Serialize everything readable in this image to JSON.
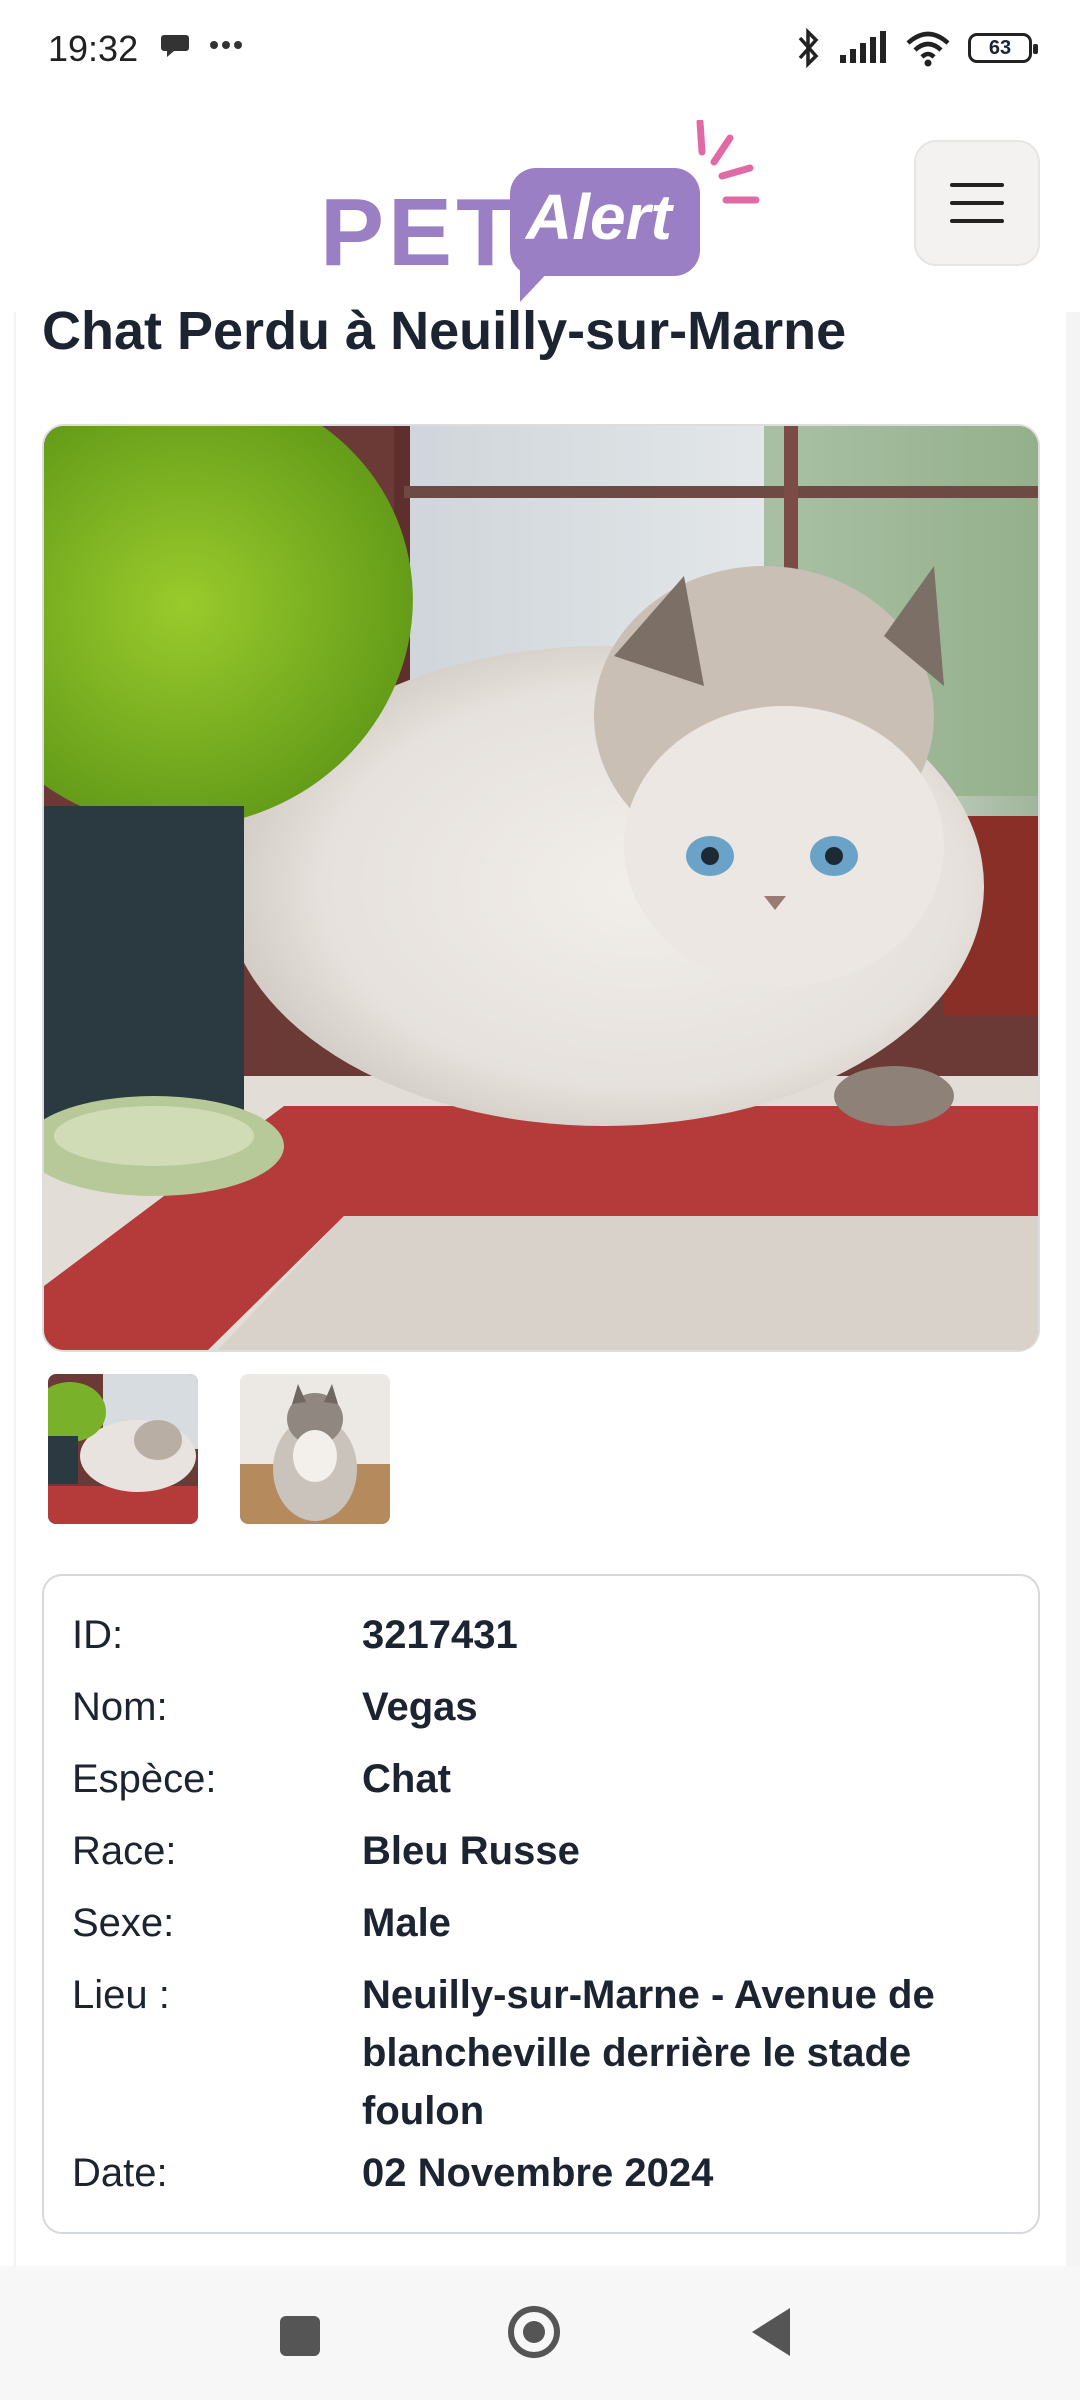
{
  "status_bar": {
    "time": "19:32",
    "battery": "63",
    "icons": [
      "chat-bubble-icon",
      "more-dots-icon",
      "bluetooth-icon",
      "signal-icon",
      "wifi-icon",
      "battery-icon"
    ]
  },
  "header": {
    "logo_pet": "PET",
    "logo_alert": "Alert",
    "menu_icon": "hamburger-menu-icon"
  },
  "page": {
    "title": "Chat Perdu à Neuilly-sur-Marne"
  },
  "photos": {
    "main": "cat-photo",
    "thumbnails": [
      "cat-thumbnail-1",
      "cat-thumbnail-2"
    ]
  },
  "details": {
    "id_label": "ID:",
    "id_value": "3217431",
    "nom_label": "Nom:",
    "nom_value": "Vegas",
    "espece_label": "Espèce:",
    "espece_value": "Chat",
    "race_label": "Race:",
    "race_value": "Bleu Russe",
    "sexe_label": "Sexe:",
    "sexe_value": "Male",
    "lieu_label": "Lieu :",
    "lieu_value": "Neuilly-sur-Marne -  Avenue de blancheville derrière le stade foulon",
    "date_label": "Date:",
    "date_value": "02 Novembre 2024"
  },
  "colors": {
    "brand_purple": "#9b7fc5",
    "brand_pink": "#e06aa6",
    "text_dark": "#1b2430"
  }
}
